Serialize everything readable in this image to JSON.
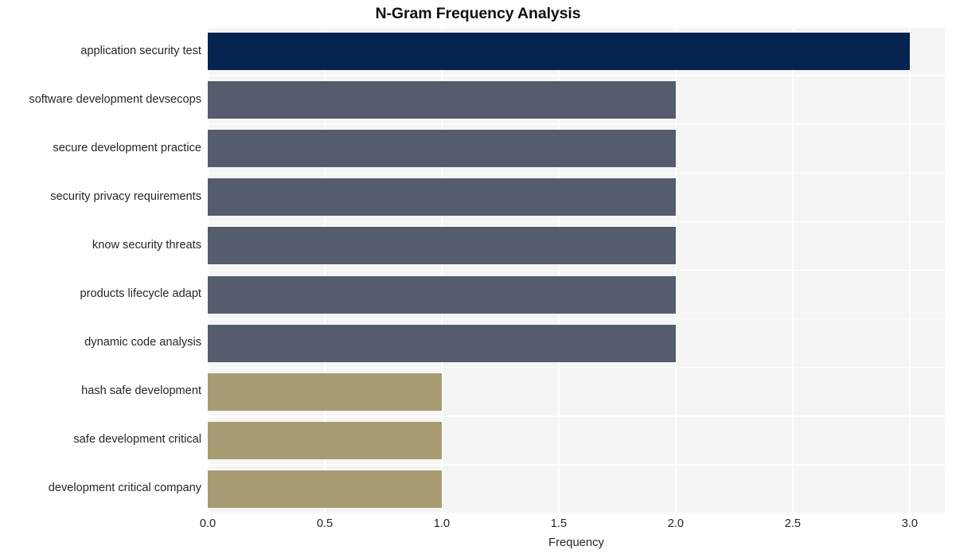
{
  "chart_data": {
    "type": "bar",
    "orientation": "horizontal",
    "title": "N-Gram Frequency Analysis",
    "xlabel": "Frequency",
    "ylabel": "",
    "xlim": [
      0.0,
      3.15
    ],
    "xticks": [
      "0.0",
      "0.5",
      "1.0",
      "1.5",
      "2.0",
      "2.5",
      "3.0"
    ],
    "xtick_values": [
      0.0,
      0.5,
      1.0,
      1.5,
      2.0,
      2.5,
      3.0
    ],
    "grid": true,
    "legend": "none",
    "categories": [
      "application security test",
      "software development devsecops",
      "secure development practice",
      "security privacy requirements",
      "know security threats",
      "products lifecycle adapt",
      "dynamic code analysis",
      "hash safe development",
      "safe development critical",
      "development critical company"
    ],
    "values": [
      3,
      2,
      2,
      2,
      2,
      2,
      2,
      1,
      1,
      1
    ],
    "bar_colors": [
      "#04234f",
      "#555c6e",
      "#555c6e",
      "#555c6e",
      "#555c6e",
      "#555c6e",
      "#555c6e",
      "#a79b72",
      "#a79b72",
      "#a79b72"
    ]
  },
  "style": {
    "figure_background": "#ffffff",
    "plot_background": "#f5f5f5",
    "grid_color": "#ffffff",
    "text_color": "#262626",
    "title_color": "#111111"
  }
}
